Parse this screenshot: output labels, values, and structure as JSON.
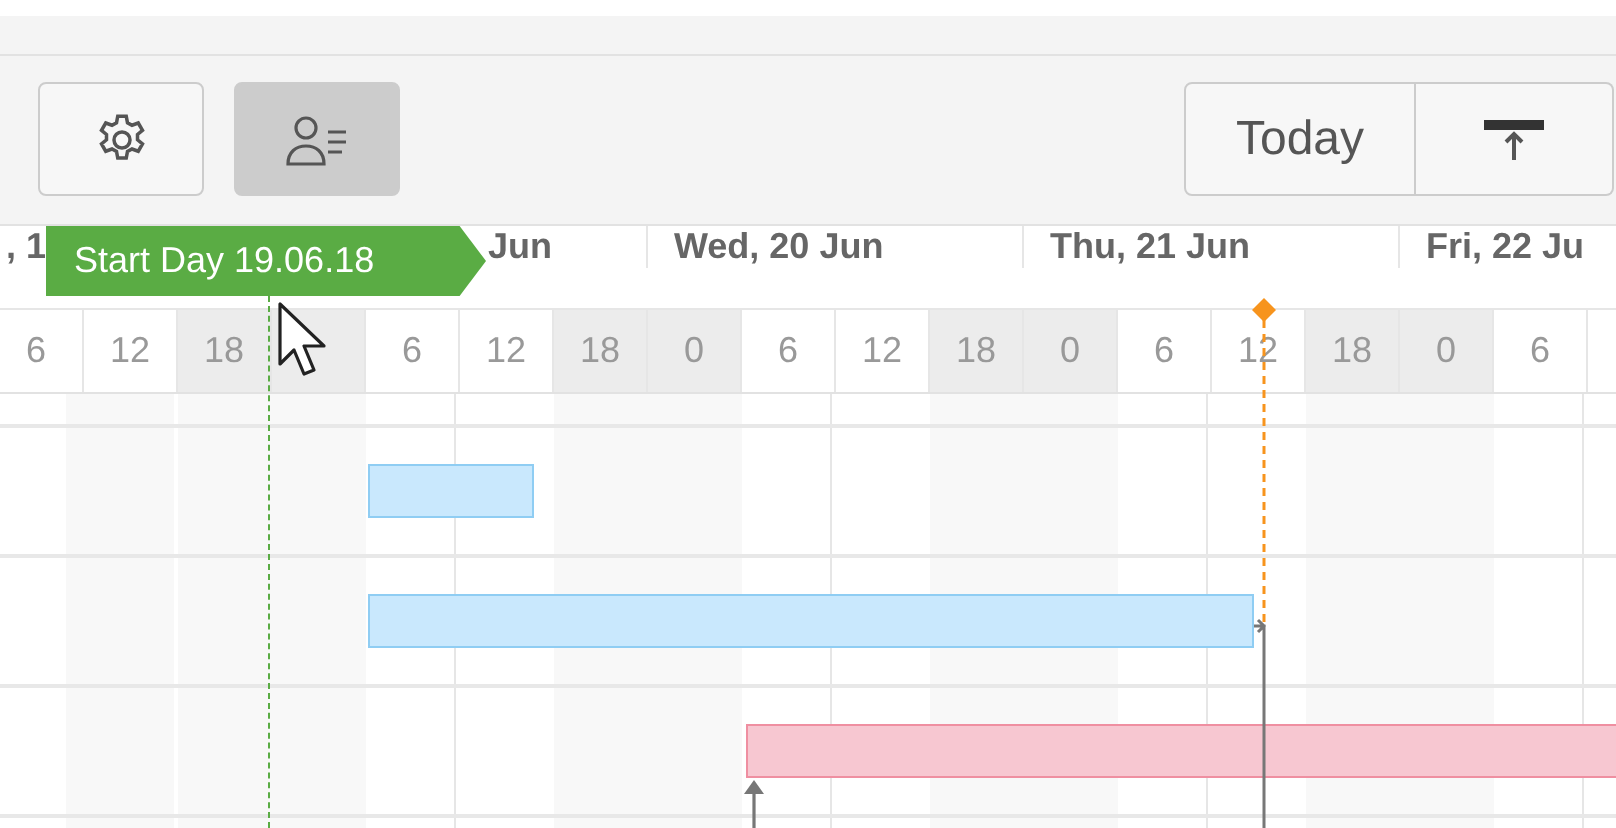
{
  "toolbar": {
    "left_buttons": [
      {
        "selected": false
      },
      {
        "selected": true
      }
    ],
    "today_button": "Today"
  },
  "timescale": {
    "days": [
      {
        "label": ", 1"
      },
      {
        "label": "Jun"
      },
      {
        "label": "Wed, 20 Jun"
      },
      {
        "label": "Thu, 21 Jun"
      },
      {
        "label": "Fri, 22 Ju"
      }
    ],
    "hours": [
      {
        "label": "6",
        "shaded": false
      },
      {
        "label": "12",
        "shaded": false
      },
      {
        "label": "18",
        "shaded": true
      },
      {
        "shaded": true
      },
      {
        "label": "6",
        "shaded": false
      },
      {
        "label": "12",
        "shaded": false
      },
      {
        "label": "18",
        "shaded": true
      },
      {
        "label": "0",
        "shaded": true
      },
      {
        "label": "6",
        "shaded": false
      },
      {
        "label": "12",
        "shaded": false
      },
      {
        "label": "18",
        "shaded": true
      },
      {
        "label": "0",
        "shaded": true
      },
      {
        "label": "6",
        "shaded": false
      },
      {
        "label": "12",
        "shaded": false
      },
      {
        "label": "18",
        "shaded": true
      },
      {
        "label": "0",
        "shaded": true
      },
      {
        "label": "6",
        "shaded": false
      }
    ]
  },
  "tasks": [
    {
      "color": "#c9e8fd"
    },
    {
      "color": "#c9e8fd"
    },
    {
      "color": "#f7c7d1"
    }
  ],
  "markers": [
    {
      "kind": "start",
      "label": "Start Day 19.06.18",
      "color": "#5aac44"
    },
    {
      "kind": "now",
      "color": "#f7941d"
    }
  ]
}
